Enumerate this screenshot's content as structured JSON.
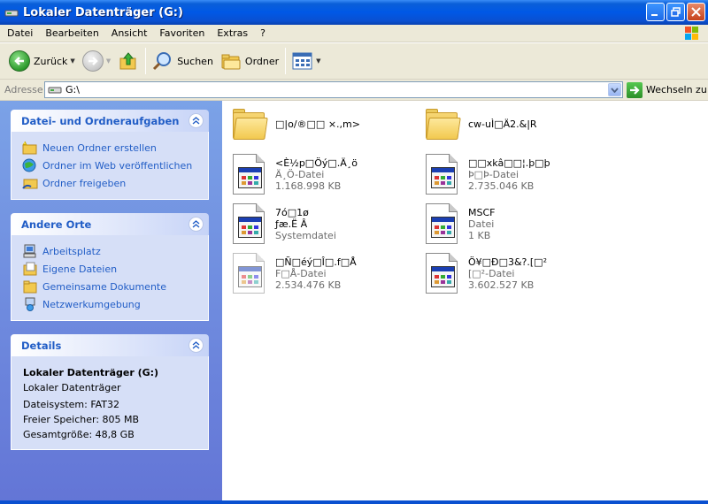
{
  "window": {
    "title": "Lokaler Datenträger (G:)",
    "buttons": [
      "minimize",
      "restore",
      "close"
    ]
  },
  "menu": [
    "Datei",
    "Bearbeiten",
    "Ansicht",
    "Favoriten",
    "Extras",
    "?"
  ],
  "toolbar": {
    "back_label": "Zurück",
    "search_label": "Suchen",
    "folders_label": "Ordner"
  },
  "address": {
    "label": "Adresse",
    "value": "G:\\",
    "go_label": "Wechseln zu"
  },
  "tasks_panel": {
    "title": "Datei- und Ordneraufgaben",
    "items": [
      {
        "label": "Neuen Ordner erstellen",
        "icon": "new-folder-icon"
      },
      {
        "label": "Ordner im Web veröffentlichen",
        "icon": "web-publish-icon"
      },
      {
        "label": "Ordner freigeben",
        "icon": "share-folder-icon"
      }
    ]
  },
  "places_panel": {
    "title": "Andere Orte",
    "items": [
      {
        "label": "Arbeitsplatz",
        "icon": "my-computer-icon"
      },
      {
        "label": "Eigene Dateien",
        "icon": "my-documents-icon"
      },
      {
        "label": "Gemeinsame Dokumente",
        "icon": "shared-documents-icon"
      },
      {
        "label": "Netzwerkumgebung",
        "icon": "network-icon"
      }
    ]
  },
  "details_panel": {
    "title": "Details",
    "name": "Lokaler Datenträger (G:)",
    "type": "Lokaler Datenträger",
    "filesystem": "Dateisystem: FAT32",
    "free": "Freier Speicher: 805 MB",
    "total": "Gesamtgröße: 48,8 GB"
  },
  "files": [
    {
      "kind": "folder",
      "name": "□|o/®□□ ×.,m>"
    },
    {
      "kind": "folder",
      "name": "cw-uÌ□Ä2.&|R"
    },
    {
      "kind": "file",
      "name": "<È½p□Öý□.Ä¸ö",
      "type": "Ä¸Ö-Datei",
      "size": "1.168.998 KB"
    },
    {
      "kind": "file",
      "name": "□□xkâ□□¦.þ□þ",
      "type": "Þ□Þ-Datei",
      "size": "2.735.046 KB"
    },
    {
      "kind": "file",
      "name": "7ó□1ø",
      "name2": "ƒæ.Ë Â",
      "type": "Systemdatei"
    },
    {
      "kind": "file",
      "name": "MSCF",
      "type": "Datei",
      "size": "1 KB"
    },
    {
      "kind": "file",
      "name": "□Ñ□éý□Î□.f□Å",
      "type": "F□Å-Datei",
      "size": "2.534.476 KB",
      "faded": true
    },
    {
      "kind": "file",
      "name": "Ö¥□Ð□3&?.[□²",
      "type": "[□²-Datei",
      "size": "3.602.527 KB"
    }
  ]
}
